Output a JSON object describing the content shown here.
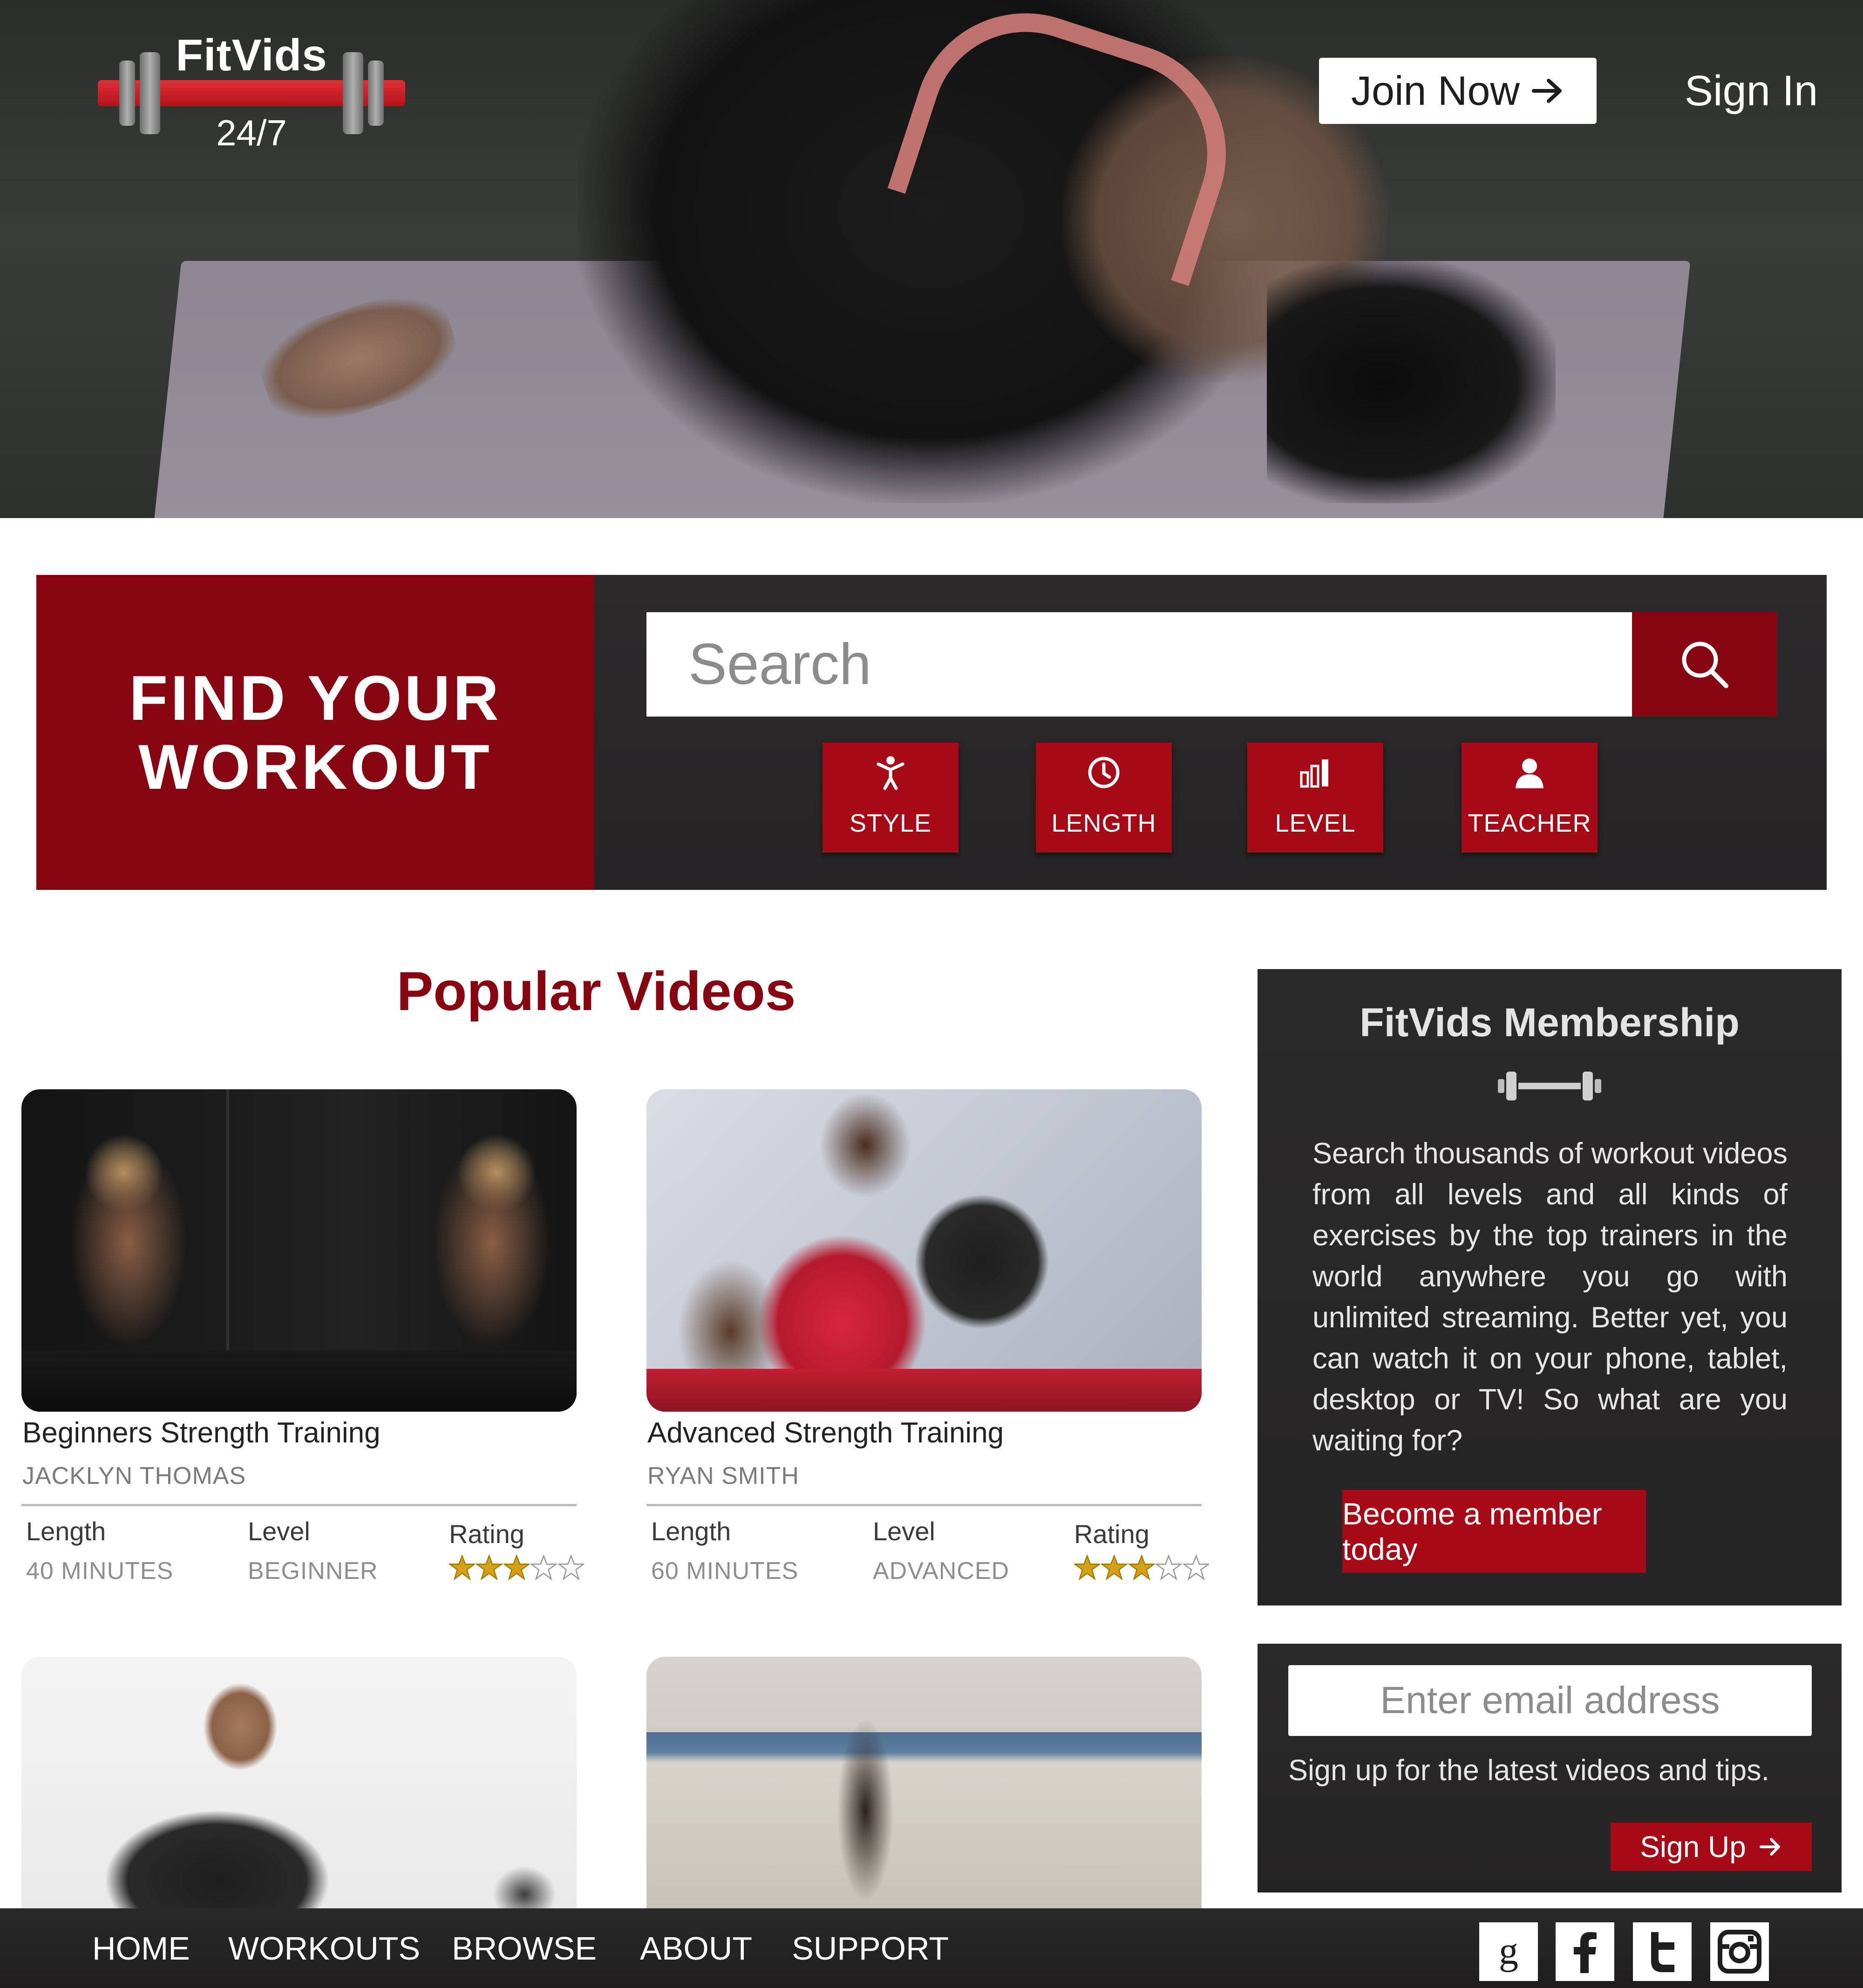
{
  "header": {
    "brand_name": "FitVids",
    "brand_tagline": "24/7",
    "join_label": "Join Now",
    "signin_label": "Sign In"
  },
  "finder": {
    "title_line1": "FIND YOUR",
    "title_line2": "WORKOUT",
    "search_placeholder": "Search",
    "filters": [
      {
        "label": "STYLE",
        "icon": "person-icon"
      },
      {
        "label": "LENGTH",
        "icon": "clock-icon"
      },
      {
        "label": "LEVEL",
        "icon": "bars-icon"
      },
      {
        "label": "TEACHER",
        "icon": "teacher-icon"
      }
    ]
  },
  "popular": {
    "title": "Popular Videos",
    "length_label": "Length",
    "level_label": "Level",
    "rating_label": "Rating",
    "videos": [
      {
        "title": "Beginners Strength Training",
        "author": "JACKLYN THOMAS",
        "length": "40 MINUTES",
        "level": "BEGINNER",
        "rating": 3,
        "max_rating": 5
      },
      {
        "title": "Advanced Strength Training",
        "author": "RYAN SMITH",
        "length": "60 MINUTES",
        "level": "ADVANCED",
        "rating": 3,
        "max_rating": 5
      }
    ]
  },
  "membership": {
    "title": "FitVids Membership",
    "description": "Search thousands of workout videos from all levels and all kinds of exercises by the top trainers in the world anywhere you go with unlimited streaming. Better yet, you can watch it on your phone, tablet, desktop or TV! So what are you waiting for?",
    "cta_label": "Become a member today"
  },
  "newsletter": {
    "email_placeholder": "Enter email address",
    "text": "Sign up for the latest videos and tips.",
    "button_label": "Sign Up"
  },
  "footer": {
    "nav": [
      "HOME",
      "WORKOUTS",
      "BROWSE",
      "ABOUT",
      "SUPPORT"
    ],
    "social": [
      "google-icon",
      "facebook-icon",
      "twitter-icon",
      "instagram-icon"
    ]
  },
  "colors": {
    "brand_red": "#870511",
    "button_red": "#a50a16",
    "panel_dark": "#2a2929",
    "star_gold": "#d4a017"
  }
}
